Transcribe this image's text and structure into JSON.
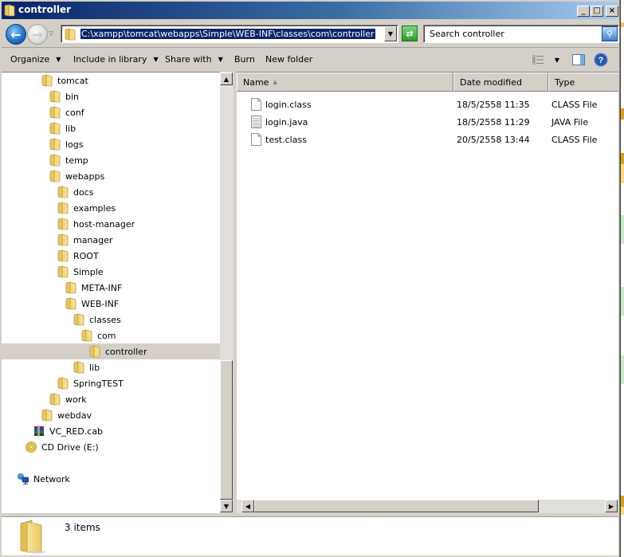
{
  "window": {
    "title": "controller",
    "controls": {
      "minimize": "_",
      "maximize": "□",
      "close": "×"
    }
  },
  "navigation": {
    "back_icon": "back-arrow-icon",
    "forward_icon": "forward-arrow-icon",
    "address_path": "C:\\xampp\\tomcat\\webapps\\Simple\\WEB-INF\\classes\\com\\controller",
    "search_placeholder": "Search controller"
  },
  "toolbar": {
    "organize": "Organize",
    "include_in_library": "Include in library",
    "share_with": "Share with",
    "burn": "Burn",
    "new_folder": "New folder"
  },
  "tree": [
    {
      "label": "tomcat",
      "level": 0,
      "icon": "folder"
    },
    {
      "label": "bin",
      "level": 1,
      "icon": "folder"
    },
    {
      "label": "conf",
      "level": 1,
      "icon": "folder"
    },
    {
      "label": "lib",
      "level": 1,
      "icon": "folder"
    },
    {
      "label": "logs",
      "level": 1,
      "icon": "folder"
    },
    {
      "label": "temp",
      "level": 1,
      "icon": "folder"
    },
    {
      "label": "webapps",
      "level": 1,
      "icon": "folder"
    },
    {
      "label": "docs",
      "level": 2,
      "icon": "folder"
    },
    {
      "label": "examples",
      "level": 2,
      "icon": "folder"
    },
    {
      "label": "host-manager",
      "level": 2,
      "icon": "folder"
    },
    {
      "label": "manager",
      "level": 2,
      "icon": "folder"
    },
    {
      "label": "ROOT",
      "level": 2,
      "icon": "folder"
    },
    {
      "label": "Simple",
      "level": 2,
      "icon": "folder"
    },
    {
      "label": "META-INF",
      "level": 3,
      "icon": "folder"
    },
    {
      "label": "WEB-INF",
      "level": 3,
      "icon": "folder"
    },
    {
      "label": "classes",
      "level": 4,
      "icon": "folder"
    },
    {
      "label": "com",
      "level": 5,
      "icon": "folder"
    },
    {
      "label": "controller",
      "level": 6,
      "icon": "folder",
      "selected": true
    },
    {
      "label": "lib",
      "level": 4,
      "icon": "folder"
    },
    {
      "label": "SpringTEST",
      "level": 2,
      "icon": "folder"
    },
    {
      "label": "work",
      "level": 1,
      "icon": "folder"
    },
    {
      "label": "webdav",
      "level": 0,
      "icon": "folder"
    },
    {
      "label": "VC_RED.cab",
      "level": -1,
      "icon": "archive"
    },
    {
      "label": "CD Drive (E:)",
      "level": -2,
      "icon": "cd-drive"
    },
    {
      "label": "",
      "level": -2,
      "icon": "none"
    },
    {
      "label": "Network",
      "level": -3,
      "icon": "network"
    }
  ],
  "columns": {
    "name": "Name",
    "date_modified": "Date modified",
    "type": "Type"
  },
  "files": [
    {
      "name": "login.class",
      "date": "18/5/2558 11:35",
      "type": "CLASS File",
      "icon": "file"
    },
    {
      "name": "login.java",
      "date": "18/5/2558 11:29",
      "type": "JAVA File",
      "icon": "text-file"
    },
    {
      "name": "test.class",
      "date": "20/5/2558 13:44",
      "type": "CLASS File",
      "icon": "file"
    }
  ],
  "details": {
    "item_count": "3 items"
  }
}
